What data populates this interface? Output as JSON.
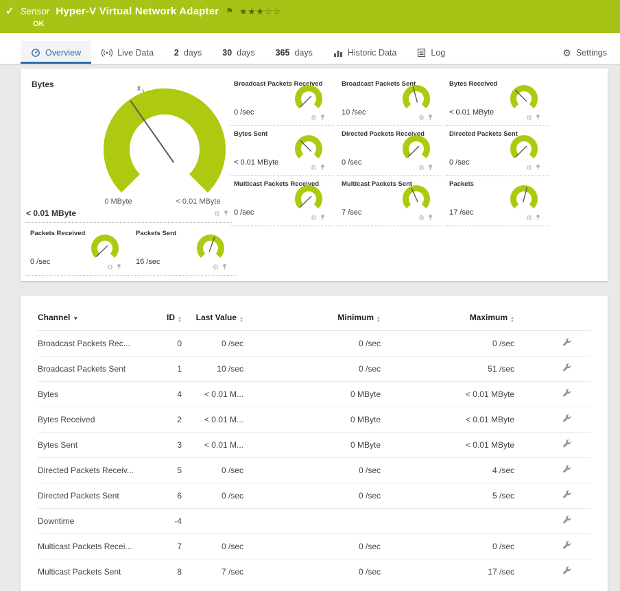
{
  "colors": {
    "header_bg": "#a5c415",
    "gauge": "#aec90f",
    "tab_active": "#2e6fb4"
  },
  "header": {
    "kind_label": "Sensor",
    "title": "Hyper-V Virtual Network Adapter",
    "status": "OK",
    "rating_filled": 3,
    "rating_total": 5
  },
  "tabs": [
    {
      "label": "Overview",
      "icon": "overview",
      "active": true
    },
    {
      "label": "Live Data",
      "icon": "live-data"
    },
    {
      "number": "2",
      "label": "days"
    },
    {
      "number": "30",
      "label": "days"
    },
    {
      "number": "365",
      "label": "days"
    },
    {
      "label": "Historic Data",
      "icon": "historic-data"
    },
    {
      "label": "Log",
      "icon": "log"
    },
    {
      "label": "Settings",
      "icon": "settings",
      "right": true
    }
  ],
  "gauges": {
    "main": {
      "title": "Bytes",
      "value": "< 0.01 MByte",
      "min_label": "0 MByte",
      "max_label": "< 0.01 MByte",
      "avg_marker": "x̄",
      "needle_angle": -35
    },
    "small": [
      {
        "title": "Broadcast Packets Received",
        "value": "0 /sec",
        "needle_angle": -135
      },
      {
        "title": "Broadcast Packets Sent",
        "value": "10 /sec",
        "needle_angle": -15
      },
      {
        "title": "Bytes Received",
        "value": "< 0.01 MByte",
        "needle_angle": -45
      },
      {
        "title": "Bytes Sent",
        "value": "< 0.01 MByte",
        "needle_angle": -45
      },
      {
        "title": "Directed Packets Received",
        "value": "0 /sec",
        "needle_angle": -135
      },
      {
        "title": "Directed Packets Sent",
        "value": "0 /sec",
        "needle_angle": -135
      },
      {
        "title": "Multicast Packets Received",
        "value": "0 /sec",
        "needle_angle": -135
      },
      {
        "title": "Multicast Packets Sent",
        "value": "7 /sec",
        "needle_angle": -25
      },
      {
        "title": "Packets",
        "value": "17 /sec",
        "needle_angle": 15
      },
      {
        "title": "Packets Received",
        "value": "0 /sec",
        "needle_angle": -135
      },
      {
        "title": "Packets Sent",
        "value": "16 /sec",
        "needle_angle": 20
      }
    ]
  },
  "table": {
    "columns": [
      {
        "label": "Channel",
        "sort": "desc"
      },
      {
        "label": "ID",
        "sort": "both"
      },
      {
        "label": "Last Value",
        "sort": "both"
      },
      {
        "label": "Minimum",
        "sort": "both"
      },
      {
        "label": "Maximum",
        "sort": "both"
      }
    ],
    "rows": [
      {
        "channel": "Broadcast Packets Rec...",
        "id": 0,
        "last_value": "0 /sec",
        "minimum": "0 /sec",
        "maximum": "0 /sec"
      },
      {
        "channel": "Broadcast Packets Sent",
        "id": 1,
        "last_value": "10 /sec",
        "minimum": "0 /sec",
        "maximum": "51 /sec"
      },
      {
        "channel": "Bytes",
        "id": 4,
        "last_value": "< 0.01 M...",
        "minimum": "0 MByte",
        "maximum": "< 0.01 MByte"
      },
      {
        "channel": "Bytes Received",
        "id": 2,
        "last_value": "< 0.01 M...",
        "minimum": "0 MByte",
        "maximum": "< 0.01 MByte"
      },
      {
        "channel": "Bytes Sent",
        "id": 3,
        "last_value": "< 0.01 M...",
        "minimum": "0 MByte",
        "maximum": "< 0.01 MByte"
      },
      {
        "channel": "Directed Packets Receiv...",
        "id": 5,
        "last_value": "0 /sec",
        "minimum": "0 /sec",
        "maximum": "4 /sec"
      },
      {
        "channel": "Directed Packets Sent",
        "id": 6,
        "last_value": "0 /sec",
        "minimum": "0 /sec",
        "maximum": "5 /sec"
      },
      {
        "channel": "Downtime",
        "id": -4,
        "last_value": "",
        "minimum": "",
        "maximum": ""
      },
      {
        "channel": "Multicast Packets Recei...",
        "id": 7,
        "last_value": "0 /sec",
        "minimum": "0 /sec",
        "maximum": "0 /sec"
      },
      {
        "channel": "Multicast Packets Sent",
        "id": 8,
        "last_value": "7 /sec",
        "minimum": "0 /sec",
        "maximum": "17 /sec"
      }
    ]
  }
}
